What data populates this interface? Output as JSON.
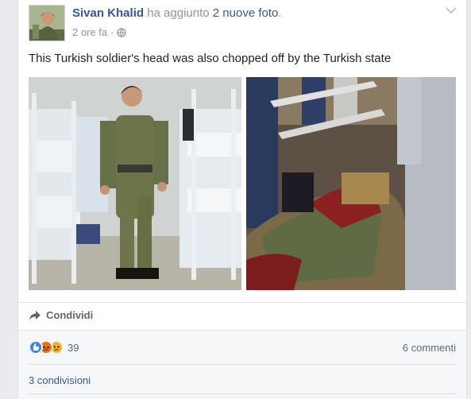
{
  "post": {
    "author": "Sivan Khalid",
    "action_prefix": "ha aggiunto",
    "action_link": "2 nuove foto",
    "action_suffix": ".",
    "time": "2 ore fa",
    "separator": "·",
    "text": "This Turkish soldier's head was also chopped off by the Turkish state"
  },
  "photos": [
    {
      "subject": "soldier-in-barracks"
    },
    {
      "subject": "body-on-ground"
    }
  ],
  "actions": {
    "share_label": "Condividi"
  },
  "stats": {
    "reaction_count": "39",
    "comments": "6 commenti",
    "shares": "3 condivisioni"
  },
  "icons": {
    "menu": "chevron-down-icon",
    "privacy": "globe-icon",
    "share": "share-arrow-icon",
    "reactions": [
      "like-icon",
      "angry-icon",
      "sad-icon"
    ]
  },
  "colors": {
    "link": "#365899",
    "muted": "#90949c",
    "like": "#4080ff",
    "angry": "#e9710f",
    "sad": "#f7b125"
  }
}
